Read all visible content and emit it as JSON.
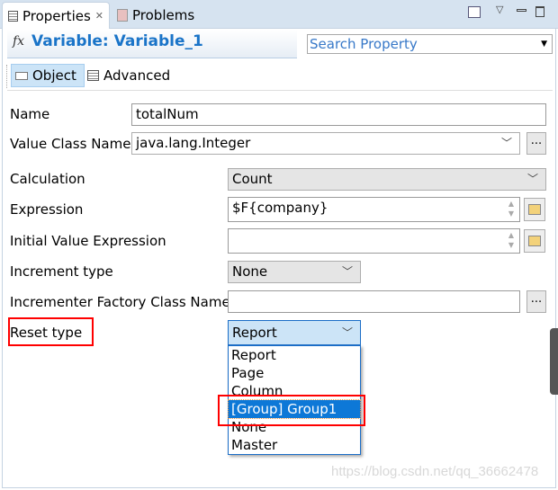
{
  "tabs": [
    {
      "label": "Properties",
      "active": true
    },
    {
      "label": "Problems",
      "active": false
    }
  ],
  "header": {
    "title": "Variable: Variable_1",
    "icon": "fx",
    "search_placeholder": "Search Property"
  },
  "subtabs": [
    {
      "label": "Object",
      "active": true
    },
    {
      "label": "Advanced",
      "active": false
    }
  ],
  "form": {
    "name": {
      "label": "Name",
      "value": "totalNum"
    },
    "value_class": {
      "label": "Value Class Name",
      "value": "java.lang.Integer",
      "button": "..."
    },
    "calculation": {
      "label": "Calculation",
      "value": "Count"
    },
    "expression": {
      "label": "Expression",
      "value": "$F{company}"
    },
    "initial_value": {
      "label": "Initial Value Expression",
      "value": ""
    },
    "increment_type": {
      "label": "Increment type",
      "value": "None"
    },
    "incrementer_factory": {
      "label": "Incrementer Factory Class Name",
      "value": "",
      "button": "..."
    },
    "reset_type": {
      "label": "Reset type",
      "value": "Report",
      "options": [
        "Report",
        "Page",
        "Column",
        "[Group] Group1",
        "None",
        "Master"
      ],
      "highlighted": "[Group] Group1"
    }
  },
  "watermark": "https://blog.csdn.net/qq_36662478",
  "colors": {
    "accent": "#1a74c8",
    "selection": "#0d78d7",
    "highlight_box": "#ff0000"
  }
}
